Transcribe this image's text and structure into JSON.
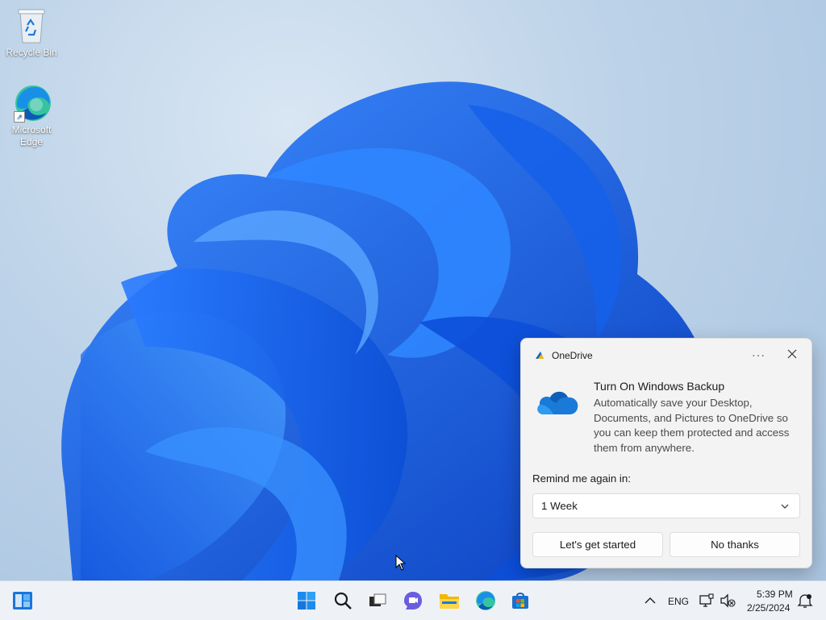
{
  "desktop": {
    "icons": [
      {
        "label": "Recycle Bin",
        "icon": "recycle-bin-icon"
      },
      {
        "label": "Microsoft Edge",
        "icon": "edge-icon"
      }
    ]
  },
  "toast": {
    "app_name": "OneDrive",
    "more_label": "···",
    "title": "Turn On Windows Backup",
    "body": "Automatically save your Desktop, Documents, and Pictures to OneDrive so you can keep them protected and access them from anywhere.",
    "remind_label": "Remind me again in:",
    "remind_value": "1 Week",
    "primary_button": "Let's get started",
    "secondary_button": "No thanks"
  },
  "taskbar": {
    "icons": [
      "widgets-icon",
      "start-icon",
      "search-icon",
      "task-view-icon",
      "chat-icon",
      "file-explorer-icon",
      "edge-icon",
      "store-icon"
    ],
    "tray": {
      "language": "ENG",
      "time": "5:39 PM",
      "date": "2/25/2024"
    }
  },
  "colors": {
    "accent": "#0067c0",
    "bloom_blue": "#1a6cf0",
    "taskbar_bg": "#eef2f7"
  }
}
